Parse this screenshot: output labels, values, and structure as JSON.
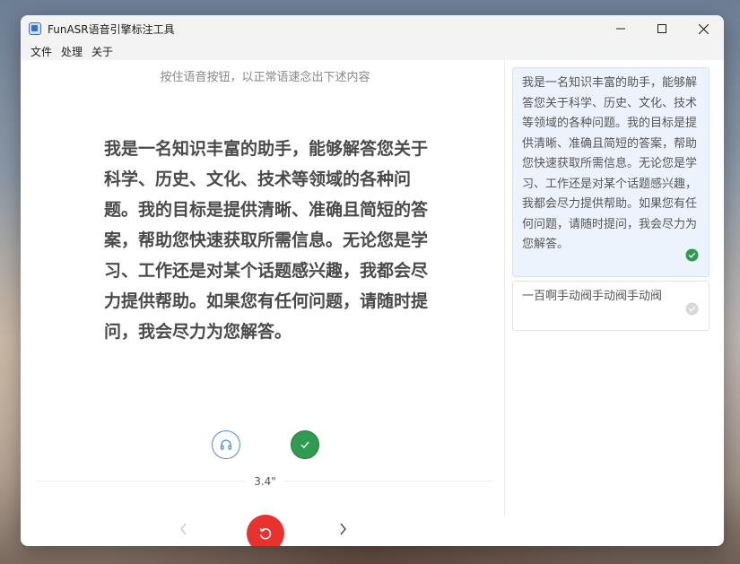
{
  "window": {
    "title": "FunASR语音引擎标注工具"
  },
  "menu": {
    "items": [
      "文件",
      "处理",
      "关于"
    ]
  },
  "main": {
    "instruction": "按住语音按钮，以正常语速念出下述内容",
    "prompt_text": "我是一名知识丰富的助手，能够解答您关于科学、历史、文化、技术等领域的各种问题。我的目标是提供清晰、准确且简短的答案，帮助您快速获取所需信息。无论您是学习、工作还是对某个话题感兴趣，我都会尽力提供帮助。如果您有任何问题，请随时提问，我会尽力为您解答。",
    "duration": "3.4\""
  },
  "sidebar": {
    "items": [
      {
        "text": "我是一名知识丰富的助手，能够解答您关于科学、历史、文化、技术等领域的各种问题。我的目标是提供清晰、准确且简短的答案，帮助您快速获取所需信息。无论您是学习、工作还是对某个话题感兴趣，我都会尽力提供帮助。如果您有任何问题，请随时提问，我会尽力为您解答。",
        "status": "done"
      },
      {
        "text": "一百啊手动阀手动阀手动阀",
        "status": "pending"
      }
    ]
  },
  "colors": {
    "accent": "#4a8ad6",
    "confirm": "#2e9b4e",
    "record": "#e8322e",
    "active_card": "#edf3fd"
  },
  "icons": [
    "app-icon",
    "minimize-icon",
    "maximize-icon",
    "close-icon",
    "headphones-icon",
    "check-icon",
    "chevron-left-icon",
    "chevron-right-icon",
    "refresh-icon"
  ]
}
